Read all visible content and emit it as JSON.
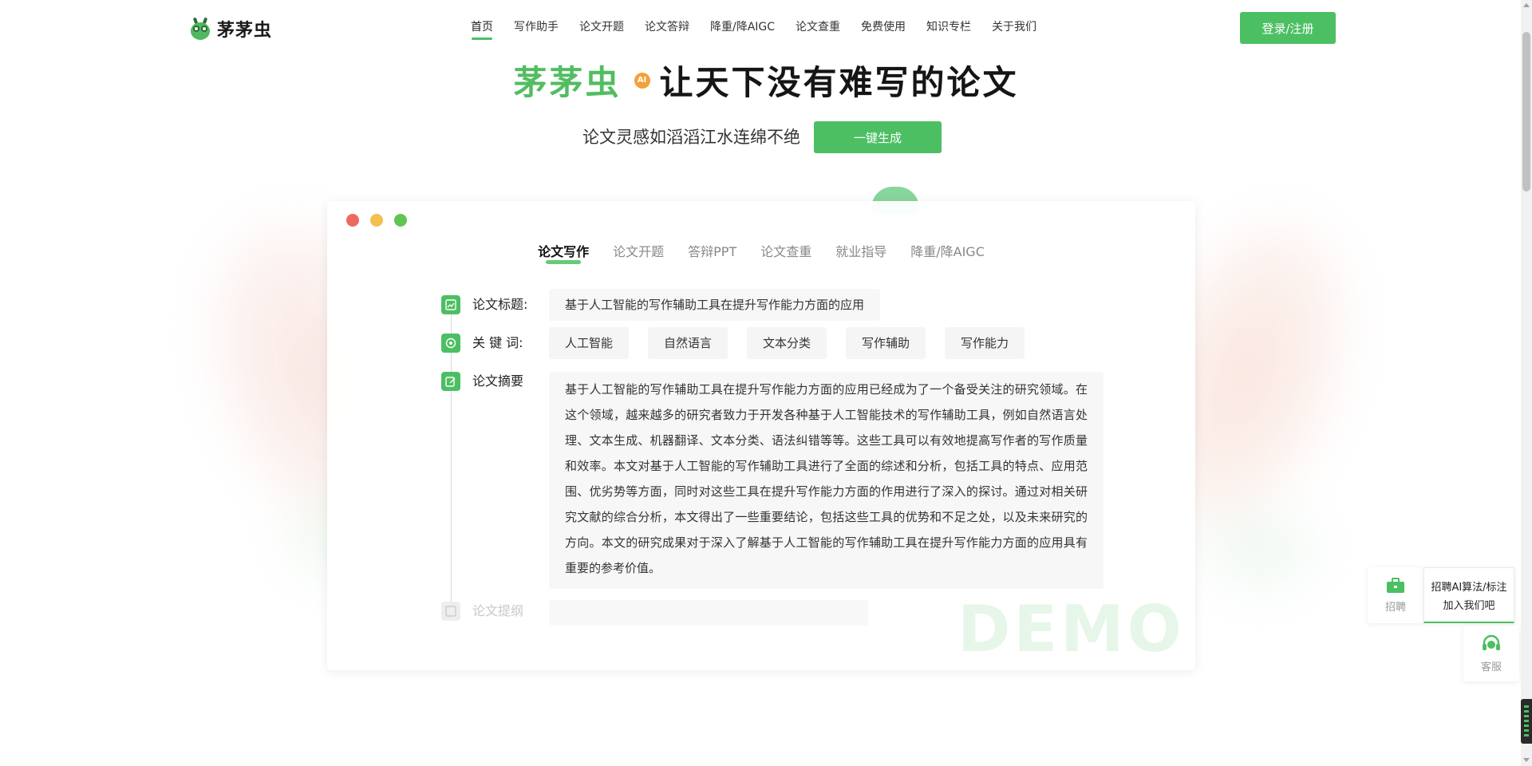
{
  "header": {
    "logo_text": "茅茅虫",
    "nav": [
      "首页",
      "写作助手",
      "论文开题",
      "论文答辩",
      "降重/降AIGC",
      "论文查重",
      "免费使用",
      "知识专栏",
      "关于我们"
    ],
    "login_label": "登录/注册"
  },
  "hero": {
    "brand": "茅茅虫",
    "ai_badge": "AI",
    "slogan": "让天下没有难写的论文",
    "subtitle": "论文灵感如滔滔江水连绵不绝",
    "generate_label": "一键生成"
  },
  "demo": {
    "tabs": [
      "论文写作",
      "论文开题",
      "答辩PPT",
      "论文查重",
      "就业指导",
      "降重/降AIGC"
    ],
    "title_label": "论文标题:",
    "title_value": "基于人工智能的写作辅助工具在提升写作能力方面的应用",
    "keywords_label": "关 键 词:",
    "keywords": [
      "人工智能",
      "自然语言",
      "文本分类",
      "写作辅助",
      "写作能力"
    ],
    "abstract_label": "论文摘要",
    "abstract": "基于人工智能的写作辅助工具在提升写作能力方面的应用已经成为了一个备受关注的研究领域。在这个领域，越来越多的研究者致力于开发各种基于人工智能技术的写作辅助工具，例如自然语言处理、文本生成、机器翻译、文本分类、语法纠错等等。这些工具可以有效地提高写作者的写作质量和效率。本文对基于人工智能的写作辅助工具进行了全面的综述和分析，包括工具的特点、应用范围、优劣势等方面，同时对这些工具在提升写作能力方面的作用进行了深入的探讨。通过对相关研究文献的综合分析，本文得出了一些重要结论，包括这些工具的优势和不足之处，以及未来研究的方向。本文的研究成果对于深入了解基于人工智能的写作辅助工具在提升写作能力方面的应用具有重要的参考价值。",
    "outline_label": "论文提纲",
    "watermark": "DEMO"
  },
  "floating": {
    "recruit_short": "招聘",
    "recruit_line1": "招聘AI算法/标注",
    "recruit_line2": "加入我们吧",
    "service_label": "客服"
  },
  "colors": {
    "accent": "#4cbf63",
    "badge": "#f3a23b"
  }
}
